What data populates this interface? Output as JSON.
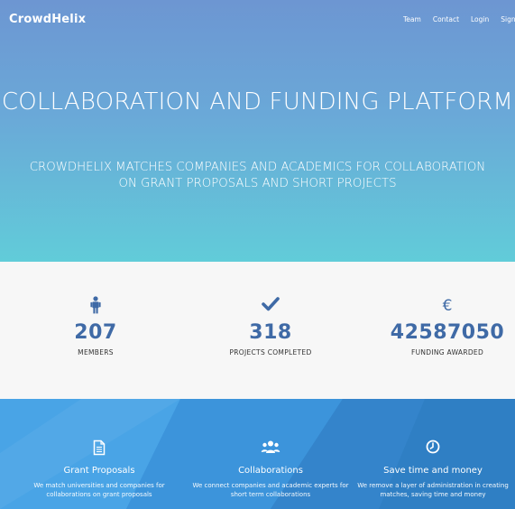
{
  "brand": "CrowdHelix",
  "nav": [
    {
      "label": "Team"
    },
    {
      "label": "Contact"
    },
    {
      "label": "Login"
    },
    {
      "label": "Sign-up"
    }
  ],
  "hero": {
    "title": "COLLABORATION AND FUNDING PLATFORM",
    "subtitle_line1": "CROWDHELIX MATCHES COMPANIES AND ACADEMICS FOR COLLABORATION",
    "subtitle_line2": "ON GRANT PROPOSALS AND SHORT PROJECTS"
  },
  "stats": [
    {
      "icon": "person-icon",
      "glyph": "👤",
      "value": "207",
      "label": "MEMBERS"
    },
    {
      "icon": "checkmark-icon",
      "glyph": "✔",
      "value": "318",
      "label": "PROJECTS COMPLETED"
    },
    {
      "icon": "euro-icon",
      "glyph": "€",
      "value": "42587050",
      "label": "FUNDING AWARDED"
    }
  ],
  "features": [
    {
      "icon": "document-icon",
      "glyph": "🗎",
      "title": "Grant Proposals",
      "text": "We match universities and companies for collaborations on grant proposals"
    },
    {
      "icon": "group-icon",
      "glyph": "👥",
      "title": "Collaborations",
      "text": "We connect companies and academic experts for short term collaborations"
    },
    {
      "icon": "clock-icon",
      "glyph": "🕘",
      "title": "Save time and money",
      "text": "We remove a layer of administration in creating matches, saving time and money"
    }
  ],
  "colors": {
    "hero_top": "#6d96d2",
    "hero_bottom": "#61ccd9",
    "stats_bg": "#f7f7f7",
    "accent": "#3f6aa6",
    "features_bg": "#3f97dd"
  }
}
